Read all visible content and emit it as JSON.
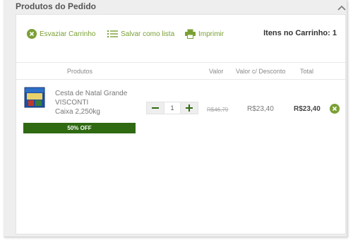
{
  "panel": {
    "title": "Produtos do Pedido"
  },
  "toolbar": {
    "empty_cart_label": "Esvaziar Carrinho",
    "save_list_label": "Salvar como lista",
    "print_label": "Imprimir",
    "cart_count_label": "Itens no Carrinho: 1"
  },
  "table": {
    "headers": [
      "Produtos",
      "Valor",
      "Valor c/ Desconto",
      "Total"
    ]
  },
  "items": [
    {
      "name_line1": "Cesta de Natal Grande",
      "name_line2": "VISCONTI",
      "name_line3": "Caixa 2,250kg",
      "badge": "50% OFF",
      "quantity": "1",
      "price": "R$46,79",
      "discounted_price": "R$23,40",
      "total": "R$23,40"
    }
  ],
  "icons": {
    "empty_cart": "x-circle-icon",
    "save_list": "list-icon",
    "print": "printer-icon",
    "remove": "x-circle-icon",
    "collapse": "chevron-up-icon",
    "decrement": "minus-icon",
    "increment": "plus-icon"
  },
  "colors": {
    "accent": "#7aa035",
    "badge_bg": "#2f6a12",
    "remove": "#7aa035"
  }
}
